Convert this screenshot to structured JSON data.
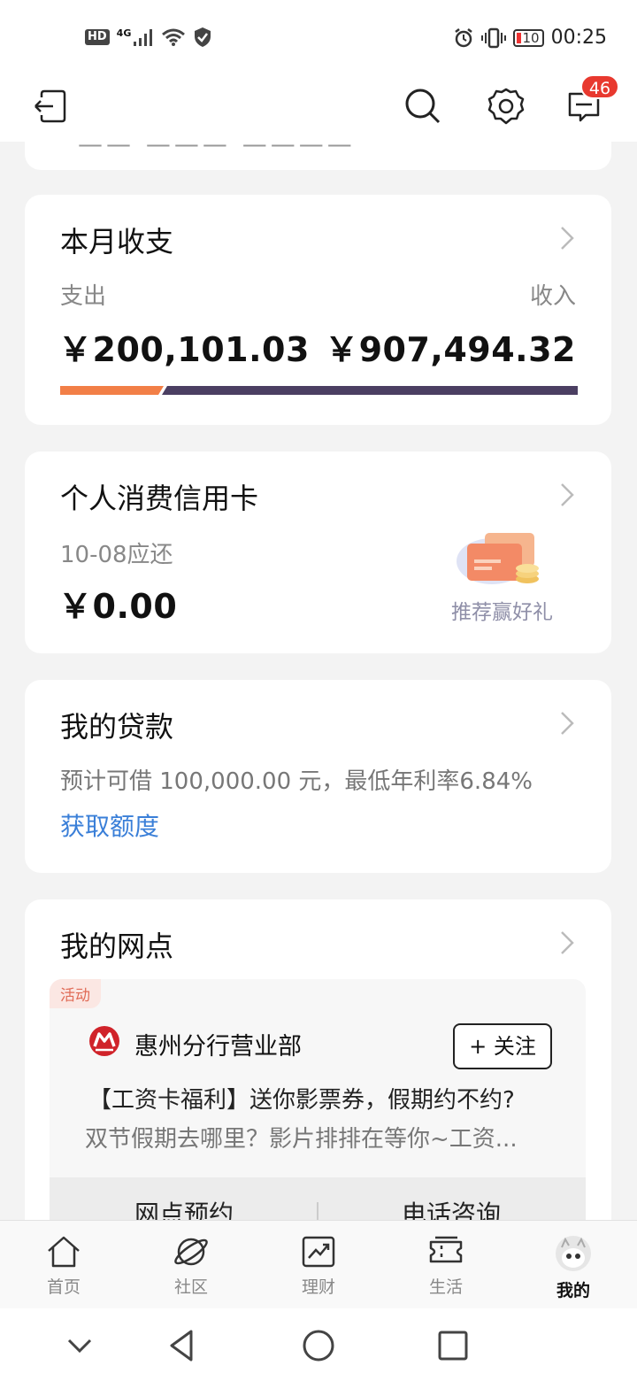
{
  "status_bar": {
    "left_badge": "HD",
    "network": "4G",
    "battery": "10",
    "time": "00:25"
  },
  "header": {
    "message_badge": "46"
  },
  "monthly": {
    "title": "本月收支",
    "expense_label": "支出",
    "income_label": "收入",
    "expense_value": "￥200,101.03",
    "income_value": "￥907,494.32",
    "expense_ratio": 0.2,
    "colors": {
      "expense": "#f27f47",
      "income": "#4b3f62"
    }
  },
  "credit_card": {
    "title": "个人消费信用卡",
    "due_label": "10-08应还",
    "amount": "￥0.00",
    "promo": "推荐赢好礼"
  },
  "loan": {
    "title": "我的贷款",
    "description": "预计可借 100,000.00 元，最低年利率6.84%",
    "link": "获取额度"
  },
  "branch": {
    "title": "我的网点",
    "tag": "活动",
    "name": "惠州分行营业部",
    "follow": "+ 关注",
    "headline": "【工资卡福利】送你影票券，假期约不约?",
    "excerpt": "双节假期去哪里？影片排排在等你~工资...",
    "action_left": "网点预约",
    "action_right": "电话咨询"
  },
  "tabs": [
    {
      "label": "首页",
      "icon": "home-icon"
    },
    {
      "label": "社区",
      "icon": "planet-icon"
    },
    {
      "label": "理财",
      "icon": "chart-icon"
    },
    {
      "label": "生活",
      "icon": "ticket-icon"
    },
    {
      "label": "我的",
      "icon": "avatar-icon"
    }
  ]
}
